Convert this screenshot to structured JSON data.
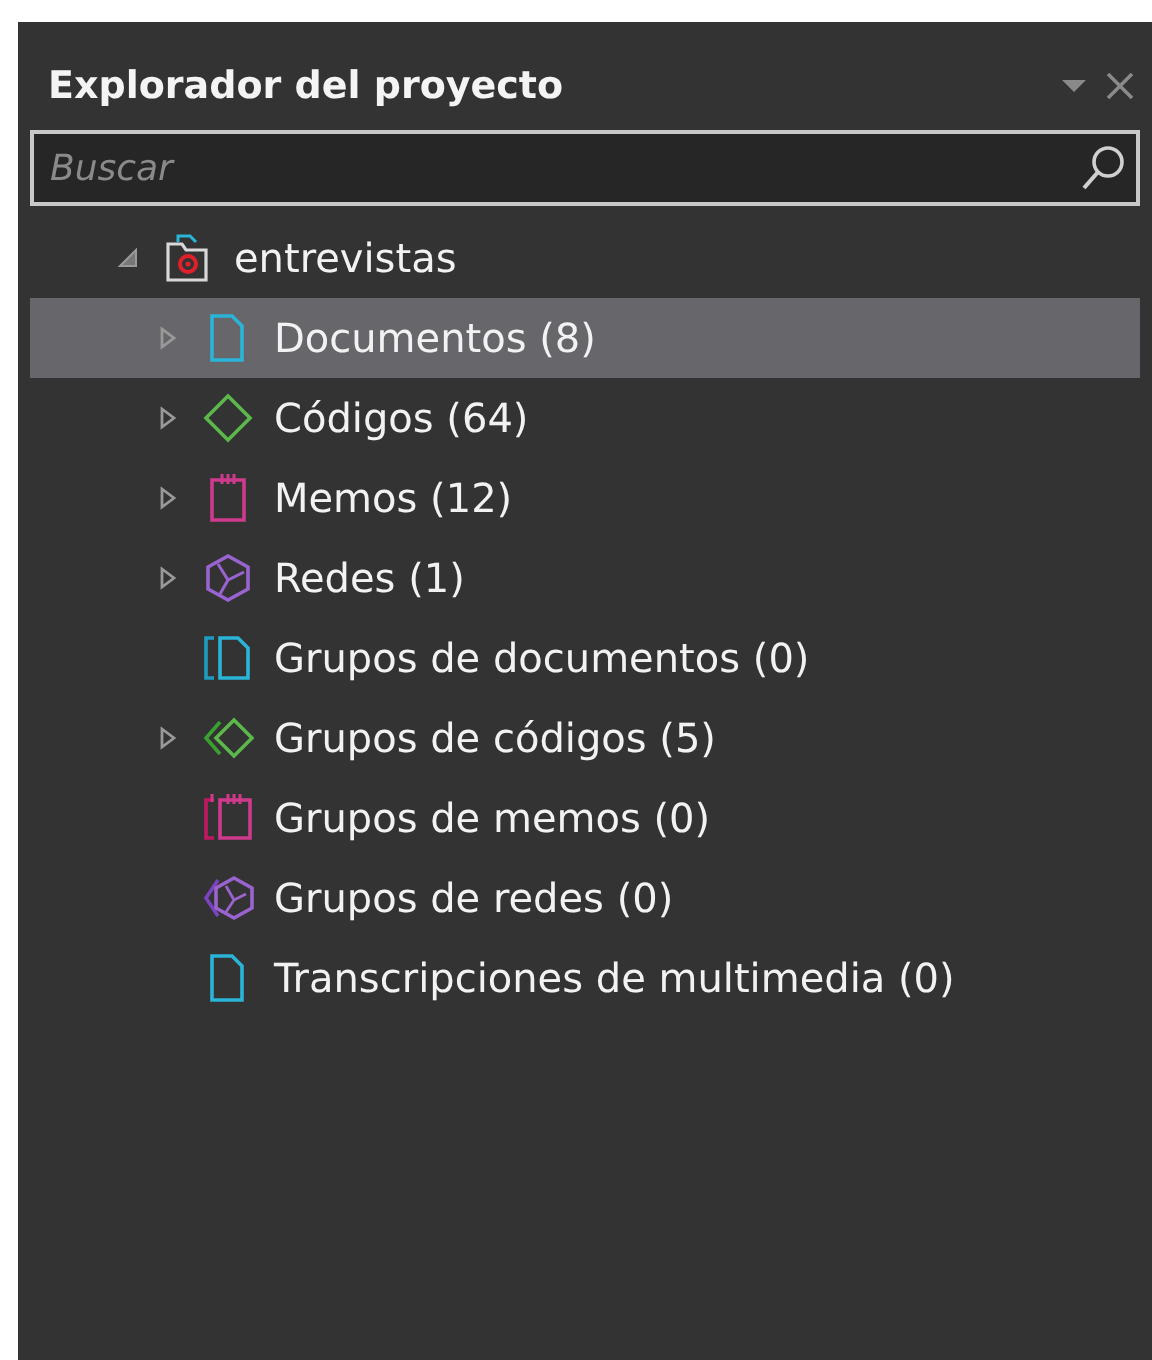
{
  "panel": {
    "title": "Explorador del proyecto"
  },
  "search": {
    "placeholder": "Buscar"
  },
  "tree": [
    {
      "label": "entrevistas",
      "kind": "project",
      "expandable": true,
      "expanded": true,
      "selected": false,
      "children": [
        {
          "label": "Documentos (8)",
          "kind": "document",
          "expandable": true,
          "expanded": false,
          "selected": true
        },
        {
          "label": "Códigos (64)",
          "kind": "code",
          "expandable": true,
          "expanded": false,
          "selected": false
        },
        {
          "label": "Memos (12)",
          "kind": "memo",
          "expandable": true,
          "expanded": false,
          "selected": false
        },
        {
          "label": "Redes (1)",
          "kind": "network",
          "expandable": true,
          "expanded": false,
          "selected": false
        },
        {
          "label": "Grupos de documentos (0)",
          "kind": "document-group",
          "expandable": false,
          "selected": false
        },
        {
          "label": "Grupos de códigos (5)",
          "kind": "code-group",
          "expandable": true,
          "expanded": false,
          "selected": false
        },
        {
          "label": "Grupos de memos (0)",
          "kind": "memo-group",
          "expandable": false,
          "selected": false
        },
        {
          "label": "Grupos de redes (0)",
          "kind": "network-group",
          "expandable": false,
          "selected": false
        },
        {
          "label": "Transcripciones de multimedia (0)",
          "kind": "transcript",
          "expandable": false,
          "selected": false
        }
      ]
    }
  ]
}
